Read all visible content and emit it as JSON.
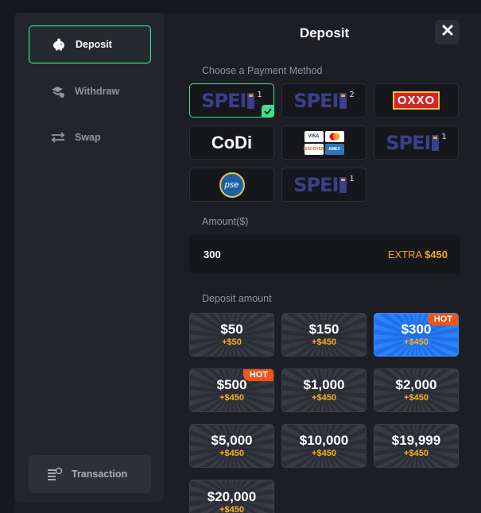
{
  "sidebar": {
    "items": [
      {
        "label": "Deposit",
        "icon": "piggy-bank-icon"
      },
      {
        "label": "Withdraw",
        "icon": "withdraw-icon"
      },
      {
        "label": "Swap",
        "icon": "swap-arrows-icon"
      }
    ],
    "transaction_label": "Transaction"
  },
  "header": {
    "title": "Deposit",
    "close_icon": "close-icon"
  },
  "payment": {
    "label": "Choose a Payment Method",
    "methods": [
      {
        "name": "SPEI",
        "sup": "1"
      },
      {
        "name": "SPEI",
        "sup": "2"
      },
      {
        "name": "OXXO"
      },
      {
        "name": "CoDi"
      },
      {
        "name": "cards",
        "brands": [
          "VISA",
          "MC",
          "DISCOVER",
          "AMEX"
        ]
      },
      {
        "name": "SPEI",
        "sup": "1"
      },
      {
        "name": "pse"
      },
      {
        "name": "SPEI",
        "sup": "1"
      }
    ]
  },
  "amount": {
    "label": "Amount($)",
    "value": "300",
    "extra_prefix": "EXTRA",
    "extra_value": "$450"
  },
  "deposit": {
    "label": "Deposit amount",
    "hot_label": "HOT",
    "tiles": [
      {
        "amount": "$50",
        "bonus": "+$50"
      },
      {
        "amount": "$150",
        "bonus": "+$450"
      },
      {
        "amount": "$300",
        "bonus": "+$450"
      },
      {
        "amount": "$500",
        "bonus": "+$450"
      },
      {
        "amount": "$1,000",
        "bonus": "+$450"
      },
      {
        "amount": "$2,000",
        "bonus": "+$450"
      },
      {
        "amount": "$5,000",
        "bonus": "+$450"
      },
      {
        "amount": "$10,000",
        "bonus": "+$450"
      },
      {
        "amount": "$19,999",
        "bonus": "+$450"
      },
      {
        "amount": "$20,000",
        "bonus": "+$450"
      }
    ]
  },
  "colors": {
    "accent_green": "#3ee08a",
    "bonus_gold": "#f5b31e",
    "hot_orange": "#f0521c",
    "selected_blue": "#2f86ff"
  }
}
